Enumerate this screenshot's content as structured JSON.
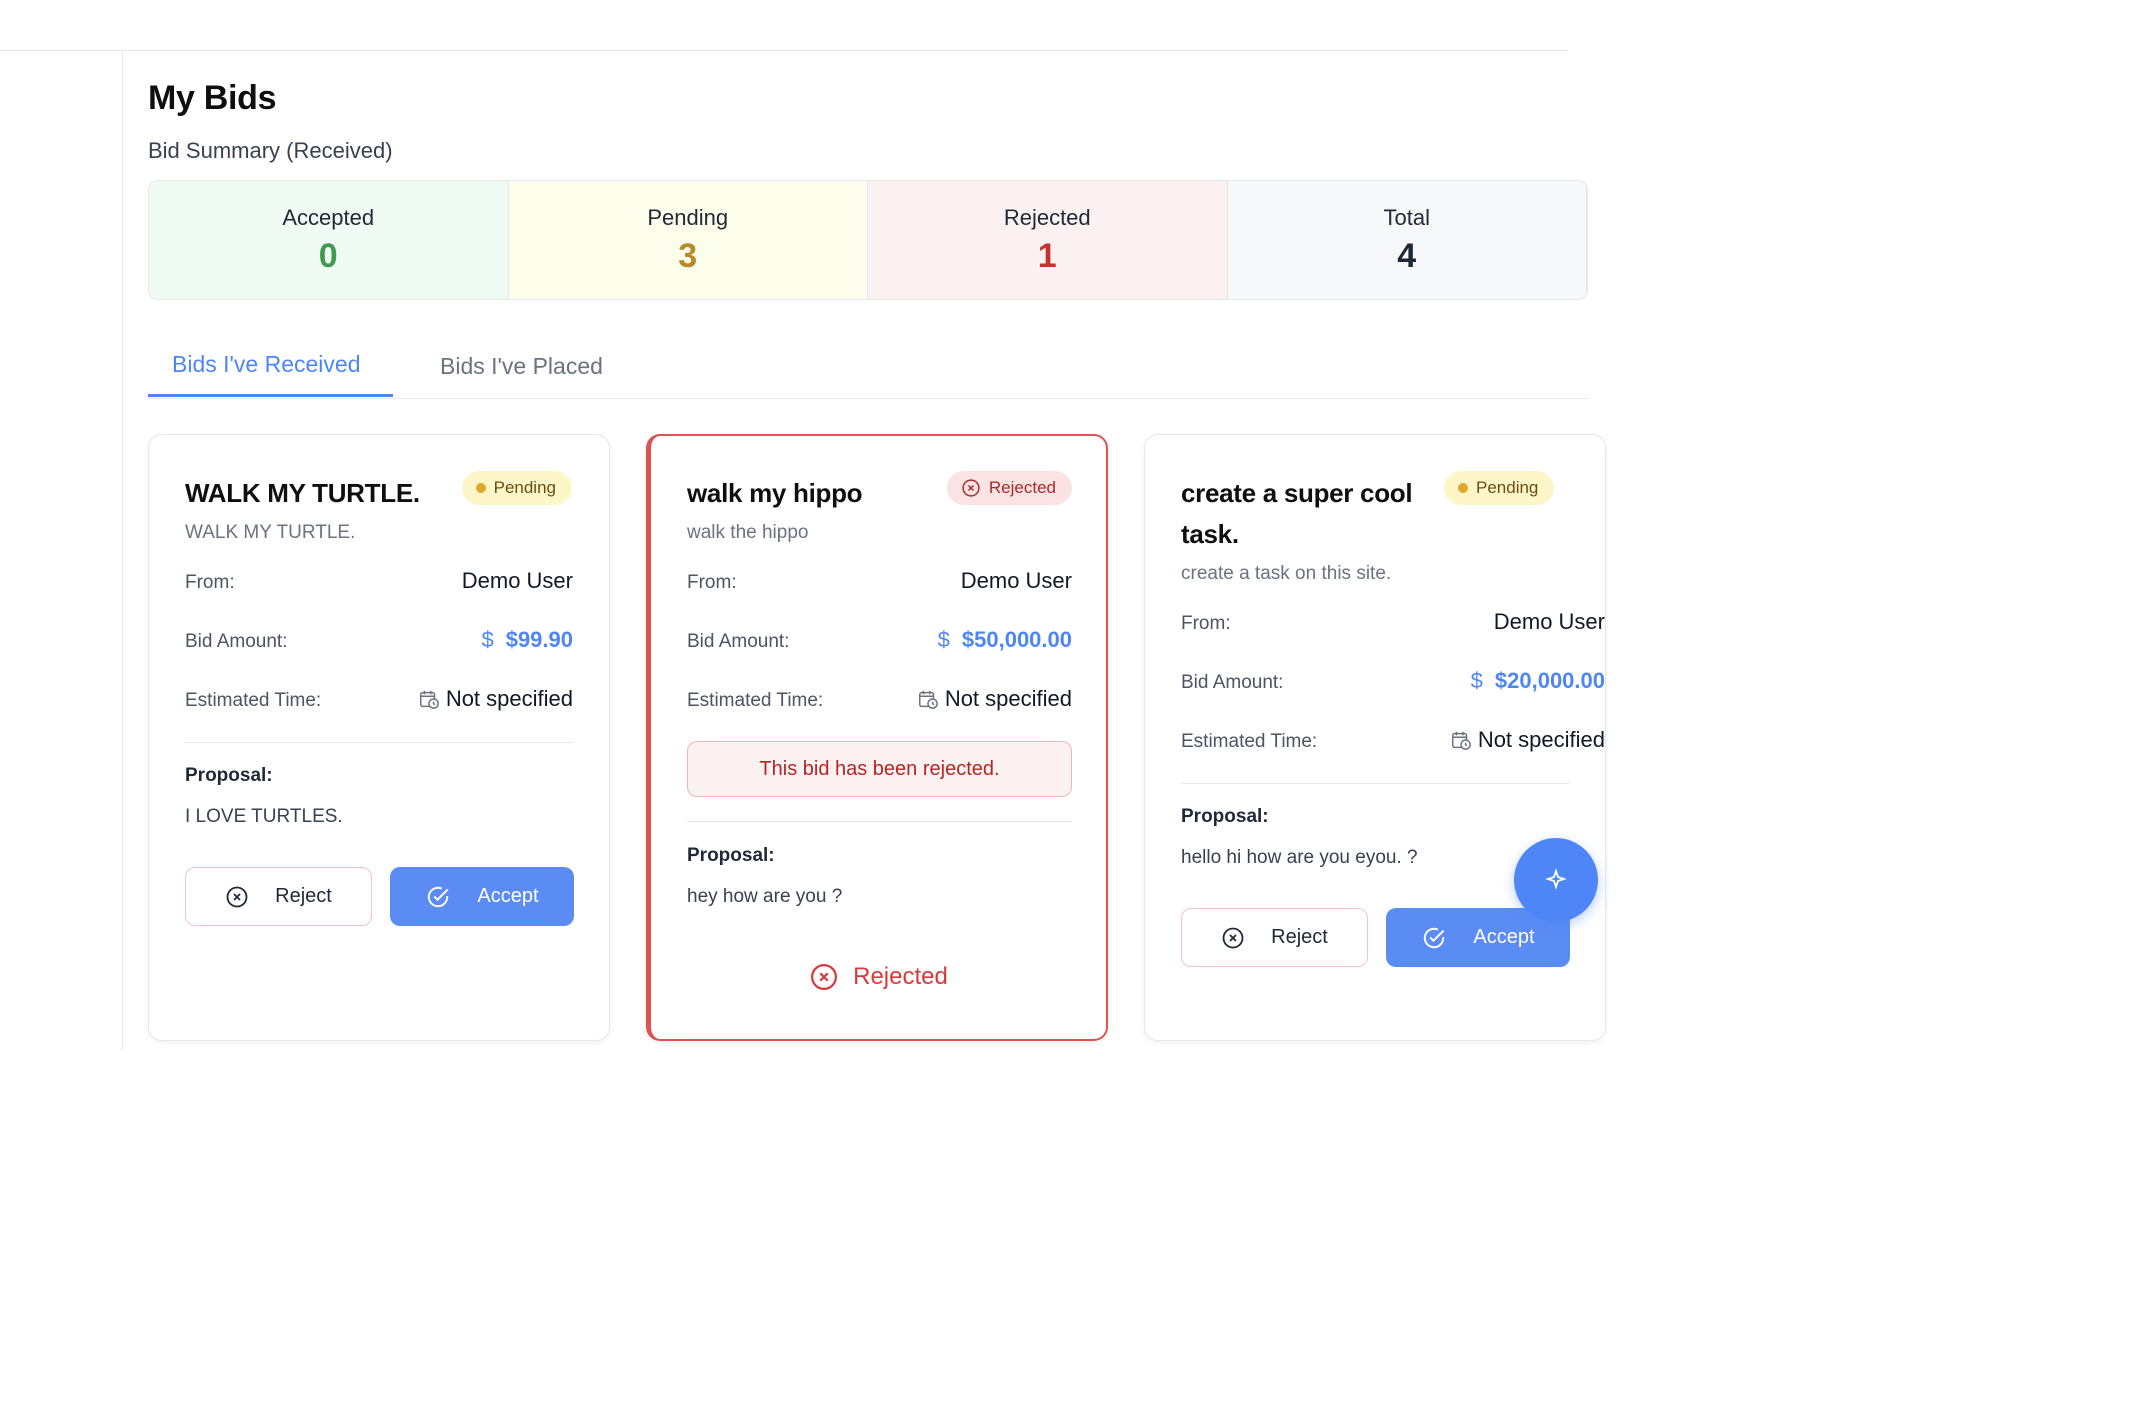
{
  "page": {
    "title": "My Bids",
    "summary_title": "Bid Summary (Received)"
  },
  "summary": [
    {
      "label": "Accepted",
      "value": "0"
    },
    {
      "label": "Pending",
      "value": "3"
    },
    {
      "label": "Rejected",
      "value": "1"
    },
    {
      "label": "Total",
      "value": "4"
    }
  ],
  "tabs": [
    {
      "label": "Bids I've Received",
      "active": true
    },
    {
      "label": "Bids I've Placed",
      "active": false
    }
  ],
  "labels": {
    "from": "From:",
    "bid_amount": "Bid Amount:",
    "estimated_time": "Estimated Time:",
    "proposal": "Proposal:",
    "reject": "Reject",
    "accept": "Accept",
    "currency_symbol": "$"
  },
  "cards": [
    {
      "title": "WALK MY TURTLE.",
      "status": "Pending",
      "description": "WALK MY TURTLE.",
      "from": "Demo User",
      "amount": "$99.90",
      "estimated_time": "Not specified",
      "proposal": "I LOVE TURTLES."
    },
    {
      "title": "walk my hippo",
      "status": "Rejected",
      "description": "walk the hippo",
      "from": "Demo User",
      "amount": "$50,000.00",
      "estimated_time": "Not specified",
      "rejected_note": "This bid has been rejected.",
      "proposal": "hey how are you ?",
      "footer_status": "Rejected"
    },
    {
      "title": "create a super cool task.",
      "status": "Pending",
      "description": "create a task on this site.",
      "from": "Demo User",
      "amount": "$20,000.00",
      "estimated_time": "Not specified",
      "proposal": "hello hi how are you eyou. ?"
    }
  ],
  "colors": {
    "accent": "#4f86f7",
    "accepted": "#3f9a4f",
    "pending": "#b58a2b",
    "rejected": "#c53030"
  }
}
